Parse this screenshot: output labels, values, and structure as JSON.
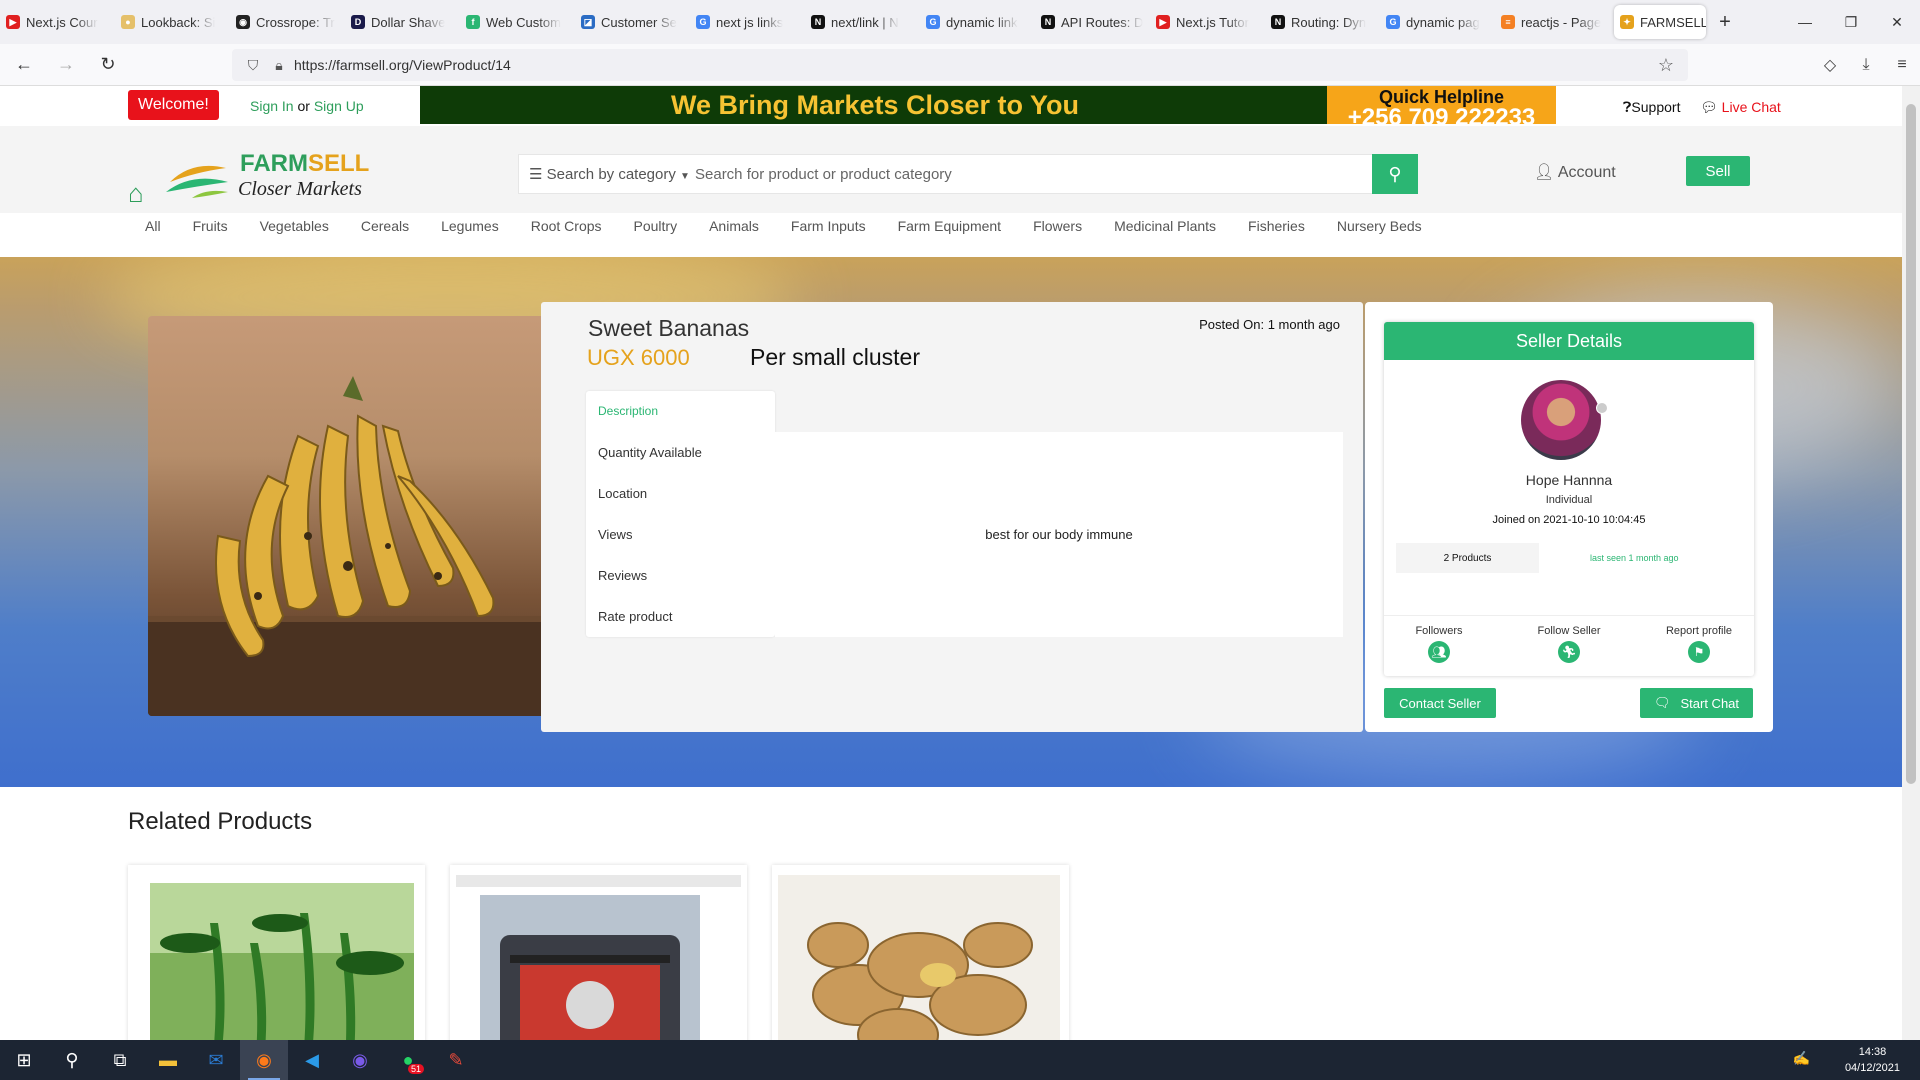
{
  "browser": {
    "tabs": [
      {
        "label": "Next.js Cour",
        "color": "#e02020",
        "glyph": "▶"
      },
      {
        "label": "Lookback: Si",
        "color": "#e5c06a",
        "glyph": "●"
      },
      {
        "label": "Crossrope: Tr",
        "color": "#222222",
        "glyph": "◉"
      },
      {
        "label": "Dollar Shave",
        "color": "#1a1a4a",
        "glyph": "D"
      },
      {
        "label": "Web Custom",
        "color": "#2bb673",
        "glyph": "f"
      },
      {
        "label": "Customer Se",
        "color": "#2b6cc4",
        "glyph": "◪"
      },
      {
        "label": "next js links",
        "color": "#4285f4",
        "glyph": "G"
      },
      {
        "label": "next/link | N",
        "color": "#111111",
        "glyph": "N"
      },
      {
        "label": "dynamic link",
        "color": "#4285f4",
        "glyph": "G"
      },
      {
        "label": "API Routes: D",
        "color": "#111111",
        "glyph": "N"
      },
      {
        "label": "Next.js Tutor",
        "color": "#e02020",
        "glyph": "▶"
      },
      {
        "label": "Routing: Dyn",
        "color": "#111111",
        "glyph": "N"
      },
      {
        "label": "dynamic pag",
        "color": "#4285f4",
        "glyph": "G"
      },
      {
        "label": "reactjs - Page",
        "color": "#f48024",
        "glyph": "≡"
      }
    ],
    "active_tab": {
      "label": "FARMSELL",
      "close": "✕"
    },
    "new_tab": "+",
    "url": "https://farmsell.org/ViewProduct/14",
    "window_controls": {
      "minimize": "—",
      "restore": "❐",
      "close": "✕"
    }
  },
  "topbar": {
    "welcome": "Welcome!",
    "sign_in": "Sign In",
    "or": "or",
    "sign_up": "Sign Up",
    "banner_slogan": "We Bring Markets Closer to You",
    "helpline_title": "Quick Helpline",
    "helpline_number": "+256 709 222233",
    "support": "Support",
    "live_chat": "Live Chat"
  },
  "header": {
    "logo_title_a": "FARM",
    "logo_title_b": "SELL",
    "logo_subtitle": "Closer Markets",
    "search_category": "Search by category",
    "search_placeholder": "Search for product or product category",
    "account": "Account",
    "sell": "Sell"
  },
  "categories": [
    "All",
    "Fruits",
    "Vegetables",
    "Cereals",
    "Legumes",
    "Root Crops",
    "Poultry",
    "Animals",
    "Farm Inputs",
    "Farm Equipment",
    "Flowers",
    "Medicinal Plants",
    "Fisheries",
    "Nursery Beds"
  ],
  "product": {
    "name": "Sweet Bananas",
    "posted": "Posted On: 1 month ago",
    "price": "UGX 6000",
    "unit": "Per small cluster",
    "tabs": [
      "Description",
      "Quantity Available",
      "Location",
      "Views",
      "Reviews",
      "Rate product"
    ],
    "active_tab": "Description",
    "description": "best for our body immune"
  },
  "seller": {
    "heading": "Seller Details",
    "name": "Hope Hannna",
    "type": "Individual",
    "joined": "Joined on 2021-10-10 10:04:45",
    "products": "2 Products",
    "last_seen": "last seen 1 month ago",
    "followers": "Followers",
    "follow": "Follow Seller",
    "report": "Report profile",
    "contact": "Contact Seller",
    "start_chat": "Start Chat"
  },
  "related": {
    "title": "Related Products"
  },
  "taskbar": {
    "whatsapp_badge": "51",
    "time": "14:38",
    "date": "04/12/2021"
  },
  "colors": {
    "brand_green": "#2bb673",
    "price_gold": "#e5a21c",
    "welcome_red": "#e8121b"
  }
}
